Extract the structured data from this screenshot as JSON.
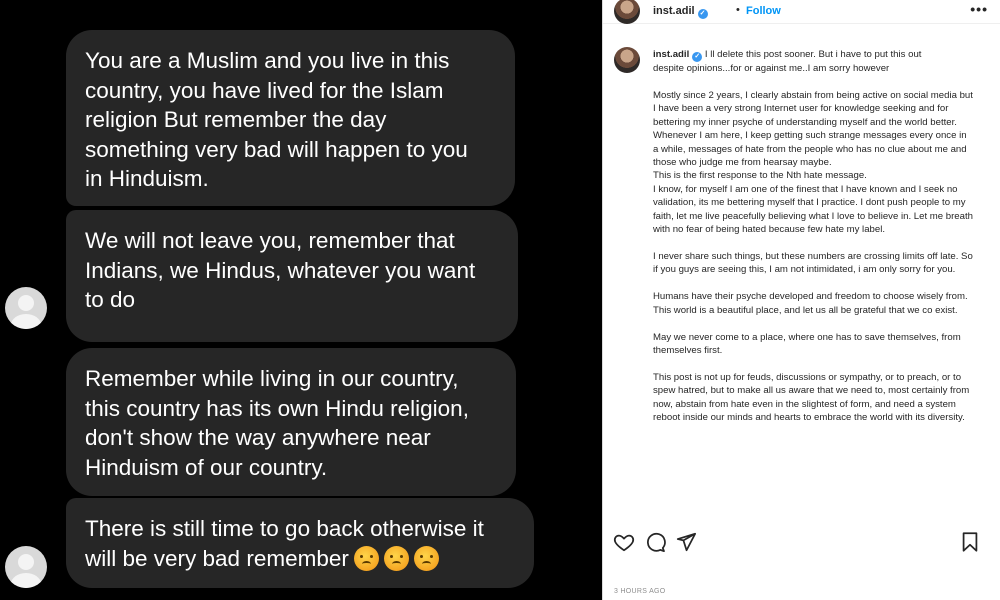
{
  "dm": {
    "messages": [
      {
        "text": "You are a Muslim and you live in this\ncountry, you have lived for the Islam\nreligion But remember the day\nsomething very bad will happen to you\nin Hinduism."
      },
      {
        "text": "We will not leave you, remember that\nIndians, we Hindus, whatever you want\nto do"
      },
      {
        "text": "Remember while living in our country,\nthis country has its own Hindu religion,\ndon't show the way anywhere near\nHinduism of our country."
      },
      {
        "text": "There is still time to go back otherwise it\nwill be very bad remember",
        "emoji": [
          "angry-face",
          "angry-face",
          "angry-face"
        ]
      }
    ],
    "bubble_color": "#262626"
  },
  "post": {
    "username": "inst.adil",
    "separator": "•",
    "follow_label": "Follow",
    "more_label": "•••",
    "caption": {
      "username": "inst.adil",
      "intro": "I ll delete this post sooner. But i have to put this out despite opinions...for or against me..I am sorry however",
      "paragraphs": [
        "Mostly since 2 years, I clearly abstain from being active on social media but I have been a very strong Internet user for knowledge seeking and for bettering my inner psyche of understanding myself and the world better. Whenever I am here, I keep getting such strange messages every once in a while, messages of hate from the people who has no clue about me and those who judge me from hearsay maybe.\nThis is the first response to the Nth hate message.\nI know, for myself I am one of the finest that I have known and I seek no validation, its me bettering myself that I practice. I dont push people to my faith, let me live peacefully believing what I love to believe in. Let me breath with no fear of being hated because few hate my label.",
        "I never share such things, but these numbers are crossing limits off late. So if you guys are seeing this, I am not intimidated, i am only sorry for you.",
        "Humans have their psyche developed and freedom to choose wisely from. This world is a beautiful place, and let us all be grateful that we co exist.",
        "May we never come to a place, where one has to save themselves, from themselves first.",
        "This post is not up for feuds, discussions or sympathy, or to preach, or to spew hatred, but to make all us aware that we need to, most certainly from now, abstain from hate even in the slightest of form, and need a system reboot inside our minds and hearts to embrace the world with its diversity."
      ]
    },
    "actions": {
      "like_icon": "heart-icon",
      "comment_icon": "comment-icon",
      "share_icon": "send-icon",
      "save_icon": "bookmark-icon"
    },
    "timestamp": "3 HOURS AGO",
    "accent_color": "#0095f6"
  }
}
